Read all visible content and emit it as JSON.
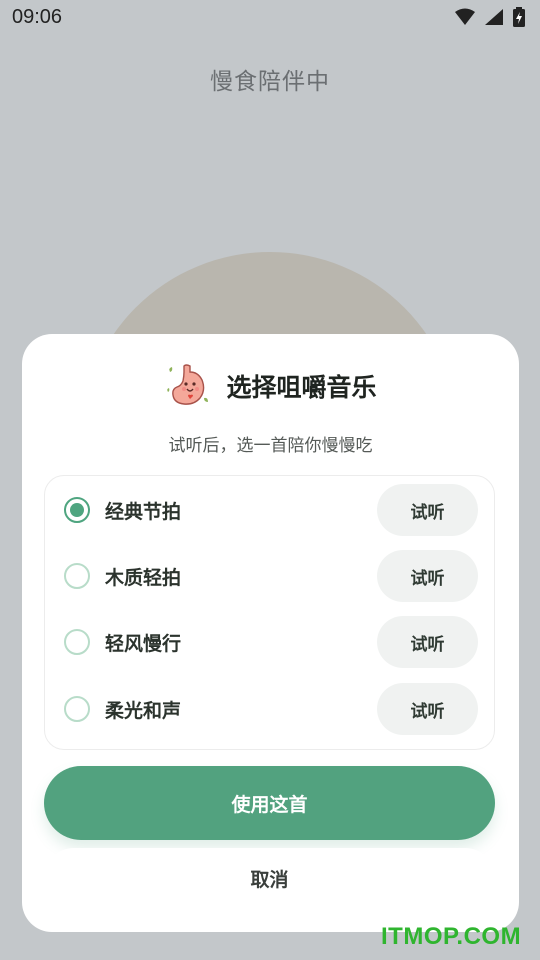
{
  "status_bar": {
    "time": "09:06"
  },
  "page": {
    "title": "慢食陪伴中"
  },
  "sheet": {
    "title": "选择咀嚼音乐",
    "subtitle": "试听后，选一首陪你慢慢吃",
    "mascot_icon": "stomach-mascot-icon",
    "options": [
      {
        "label": "经典节拍",
        "selected": true,
        "preview_label": "试听"
      },
      {
        "label": "木质轻拍",
        "selected": false,
        "preview_label": "试听"
      },
      {
        "label": "轻风慢行",
        "selected": false,
        "preview_label": "试听"
      },
      {
        "label": "柔光和声",
        "selected": false,
        "preview_label": "试听"
      }
    ],
    "confirm_label": "使用这首",
    "cancel_label": "取消"
  },
  "watermark": "ITMOP.COM",
  "colors": {
    "accent": "#52a27f",
    "background": "#c3c7ca",
    "sheet": "#ffffff"
  }
}
